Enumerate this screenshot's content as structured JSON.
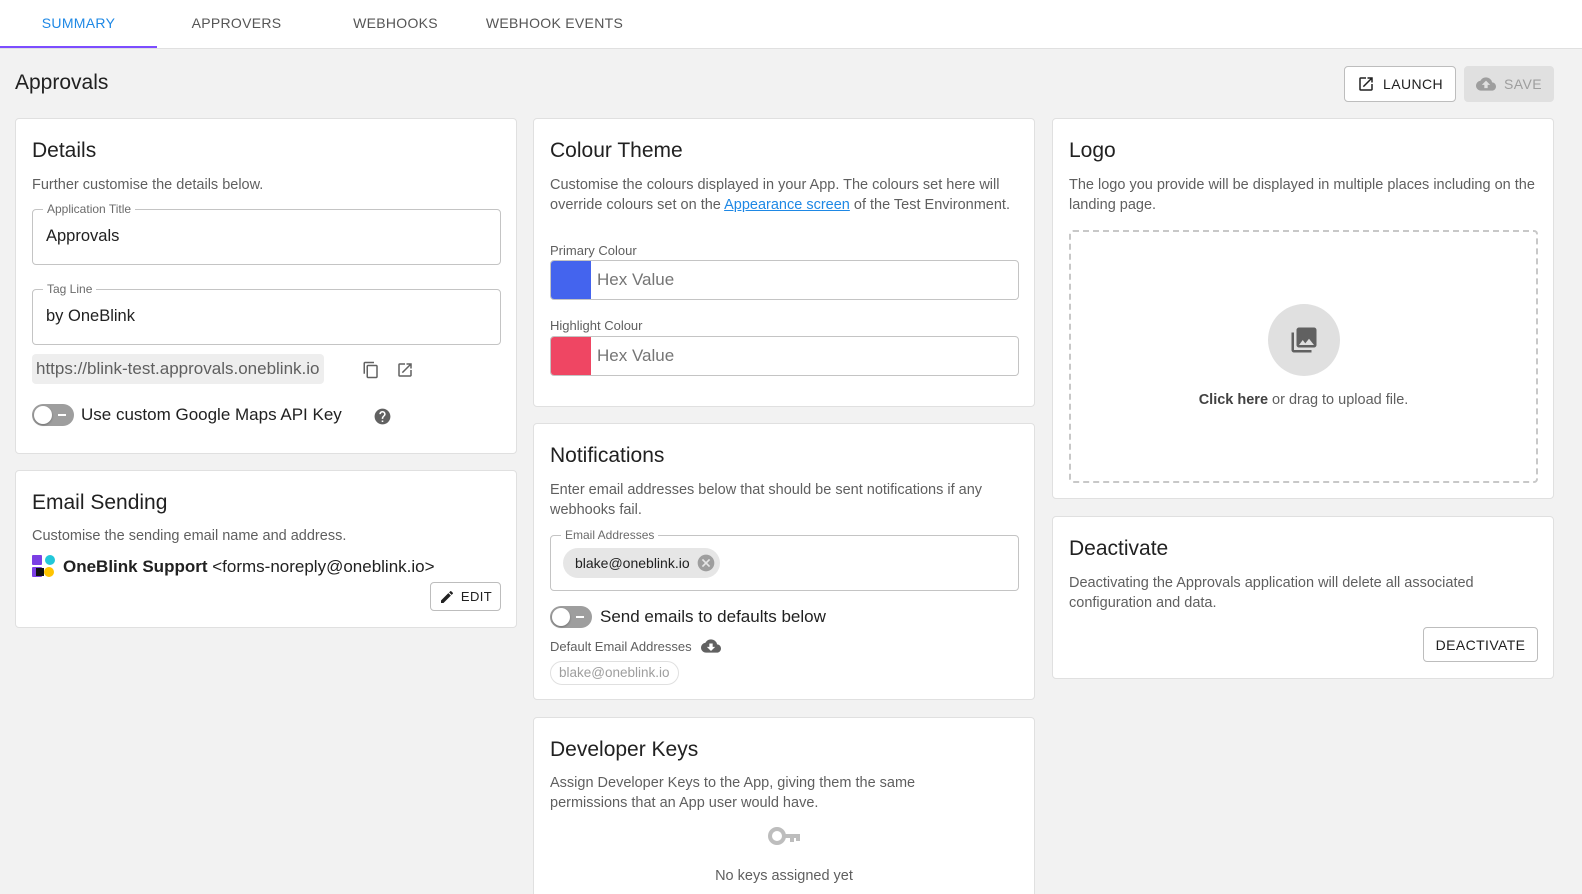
{
  "tabs": [
    {
      "label": "SUMMARY"
    },
    {
      "label": "APPROVERS"
    },
    {
      "label": "WEBHOOKS"
    },
    {
      "label": "WEBHOOK EVENTS"
    }
  ],
  "page": {
    "title": "Approvals",
    "launch_label": "LAUNCH",
    "save_label": "SAVE"
  },
  "details": {
    "title": "Details",
    "description": "Further customise the details below.",
    "app_title_label": "Application Title",
    "app_title_value": "Approvals",
    "tagline_label": "Tag Line",
    "tagline_value": "by OneBlink",
    "url": "https://blink-test.approvals.oneblink.io",
    "maps_toggle_label": "Use custom Google Maps API Key"
  },
  "email_sending": {
    "title": "Email Sending",
    "description": "Customise the sending email name and address.",
    "sender_name": "OneBlink Support",
    "sender_address": "<forms-noreply@oneblink.io>",
    "edit_label": "EDIT"
  },
  "colour_theme": {
    "title": "Colour Theme",
    "description_before": "Customise the colours displayed in your App. The colours set here will override colours set on the ",
    "description_link": "Appearance screen",
    "description_after": " of the Test Environment.",
    "primary_label": "Primary Colour",
    "primary_placeholder": "Hex Value",
    "primary_swatch": "#4464ee",
    "highlight_label": "Highlight Colour",
    "highlight_placeholder": "Hex Value",
    "highlight_swatch": "#ef4663"
  },
  "notifications": {
    "title": "Notifications",
    "description": "Enter email addresses below that should be sent notifications if any webhooks fail.",
    "email_label": "Email Addresses",
    "email_chip": "blake@oneblink.io",
    "defaults_toggle_label": "Send emails to defaults below",
    "default_label": "Default Email Addresses",
    "default_chip": "blake@oneblink.io"
  },
  "developer_keys": {
    "title": "Developer Keys",
    "description": "Assign Developer Keys to the App, giving them the same permissions that an App user would have.",
    "empty_text": "No keys assigned yet"
  },
  "logo": {
    "title": "Logo",
    "description": "The logo you provide will be displayed in multiple places including on the landing page.",
    "upload_click": "Click here",
    "upload_rest": " or drag to upload file."
  },
  "deactivate": {
    "title": "Deactivate",
    "description": "Deactivating the Approvals application will delete all associated configuration and data.",
    "button_label": "DEACTIVATE"
  },
  "colors": {
    "accent": "#1e88e5",
    "tab_indicator": "#7c4dff"
  }
}
